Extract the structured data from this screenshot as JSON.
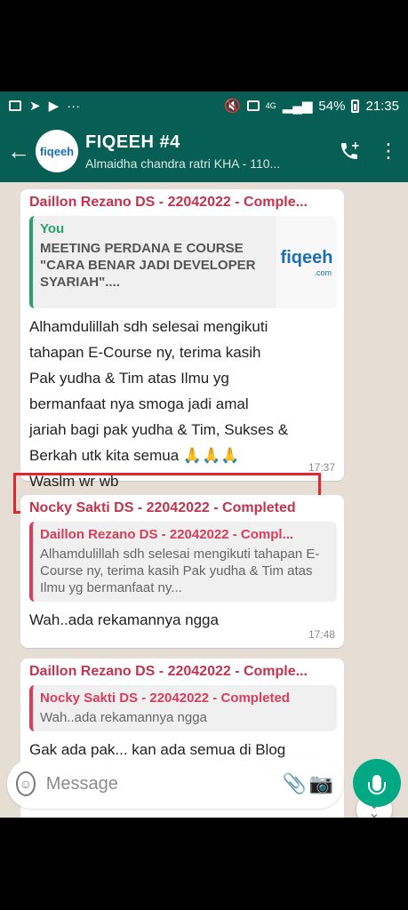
{
  "status": {
    "dots": "···",
    "signal_4g": "4G",
    "battery": "54%",
    "clock": "21:35"
  },
  "header": {
    "back": "←",
    "avatar_logo": "fiqeeh",
    "title": "FIQEEH #4",
    "subtitle": "Almaidha chandra ratri KHA - 110...",
    "add_call_icon": "phone-plus",
    "menu": "⋮"
  },
  "messages": [
    {
      "sender": "Daillon Rezano DS - 22042022 - Comple...",
      "quote": {
        "name": "You",
        "text": "MEETING PERDANA E COURSE \"CARA BENAR JADI DEVELOPER SYARIAH\"....",
        "thumb_logo": "fiqeeh",
        "thumb_suffix": ".com"
      },
      "text_lines": [
        "Alhamdulillah sdh selesai mengikuti",
        "tahapan E-Course ny, terima kasih",
        "Pak yudha & Tim atas Ilmu yg",
        "bermanfaat nya smoga jadi amal",
        "jariah bagi pak yudha & Tim, Sukses &",
        "Berkah utk kita semua 🙏🙏🙏",
        "Waslm wr wb"
      ],
      "time": "17:37"
    },
    {
      "sender": "Nocky Sakti DS - 22042022 - Completed",
      "quote": {
        "name": "Daillon Rezano DS - 22042022 - Compl...",
        "text": "Alhamdulillah sdh selesai mengikuti tahapan E-Course ny, terima kasih Pak yudha & Tim atas Ilmu yg bermanfaat ny..."
      },
      "text": "Wah..ada rekamannya ngga",
      "time": "17:48"
    },
    {
      "sender": "Daillon Rezano DS - 22042022 - Comple...",
      "quote": {
        "name": "Nocky Sakti DS - 22042022 - Completed",
        "text": "Wah..ada rekamannya ngga"
      },
      "text": "Gak ada pak... kan ada semua di Blog"
    }
  ],
  "input": {
    "placeholder": "Message"
  },
  "colors": {
    "header": "#075e54",
    "sender": "#c2334d",
    "quote_own": "#25a366",
    "mic": "#00a884",
    "highlight": "#e3262d"
  }
}
